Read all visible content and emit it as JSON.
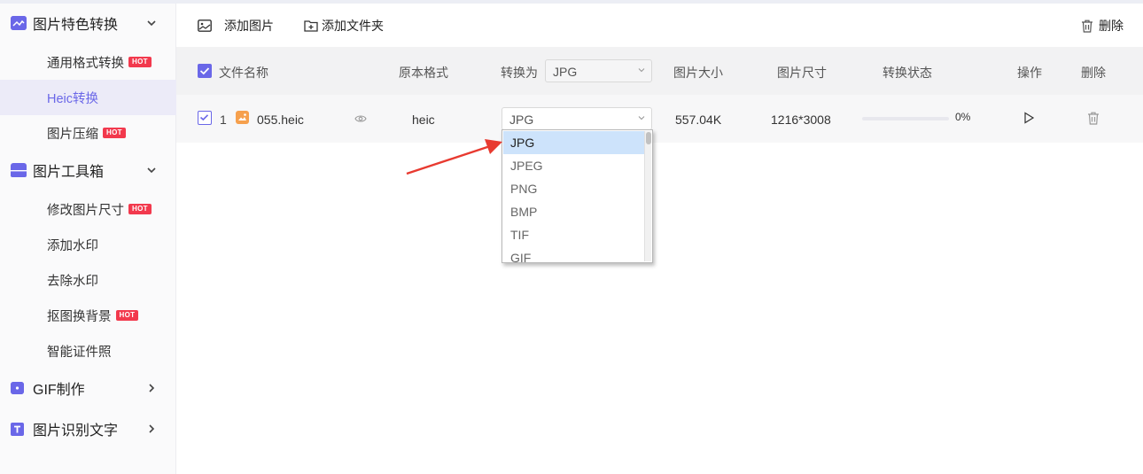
{
  "sidebar": {
    "groups": [
      {
        "label": "图片特色转换",
        "icon": "image-convert-icon",
        "expanded": true
      },
      {
        "label": "图片工具箱",
        "icon": "toolbox-icon",
        "expanded": true
      },
      {
        "label": "GIF制作",
        "icon": "gif-icon",
        "expanded": false
      },
      {
        "label": "图片识别文字",
        "icon": "text-ocr-icon",
        "expanded": false
      }
    ],
    "items": [
      {
        "label": "通用格式转换",
        "hot": "HOT"
      },
      {
        "label": "Heic转换",
        "active": true
      },
      {
        "label": "图片压缩",
        "hot": "HOT"
      },
      {
        "label": "修改图片尺寸",
        "hot": "HOT"
      },
      {
        "label": "添加水印"
      },
      {
        "label": "去除水印"
      },
      {
        "label": "抠图换背景",
        "hot": "HOT"
      },
      {
        "label": "智能证件照"
      }
    ]
  },
  "toolbar": {
    "add_image": "添加图片",
    "add_folder": "添加文件夹",
    "delete": "删除"
  },
  "table": {
    "headers": {
      "filename": "文件名称",
      "orig_format": "原本格式",
      "convert_to": "转换为",
      "convert_to_value": "JPG",
      "size": "图片大小",
      "dimensions": "图片尺寸",
      "status": "转换状态",
      "action": "操作",
      "delete": "删除"
    },
    "rows": [
      {
        "index": "1",
        "filename": "055.heic",
        "orig_format": "heic",
        "target_format": "JPG",
        "size": "557.04K",
        "dimensions": "1216*3008",
        "progress_text": "0%",
        "progress": 0
      }
    ]
  },
  "dropdown": {
    "options": [
      "JPG",
      "JPEG",
      "PNG",
      "BMP",
      "TIF",
      "GIF"
    ],
    "selected": "JPG"
  },
  "colors": {
    "accent": "#6a67e8",
    "hot_badge": "#f2394d",
    "selected_option": "#cde3fb",
    "annotation_arrow": "#e83a30"
  }
}
